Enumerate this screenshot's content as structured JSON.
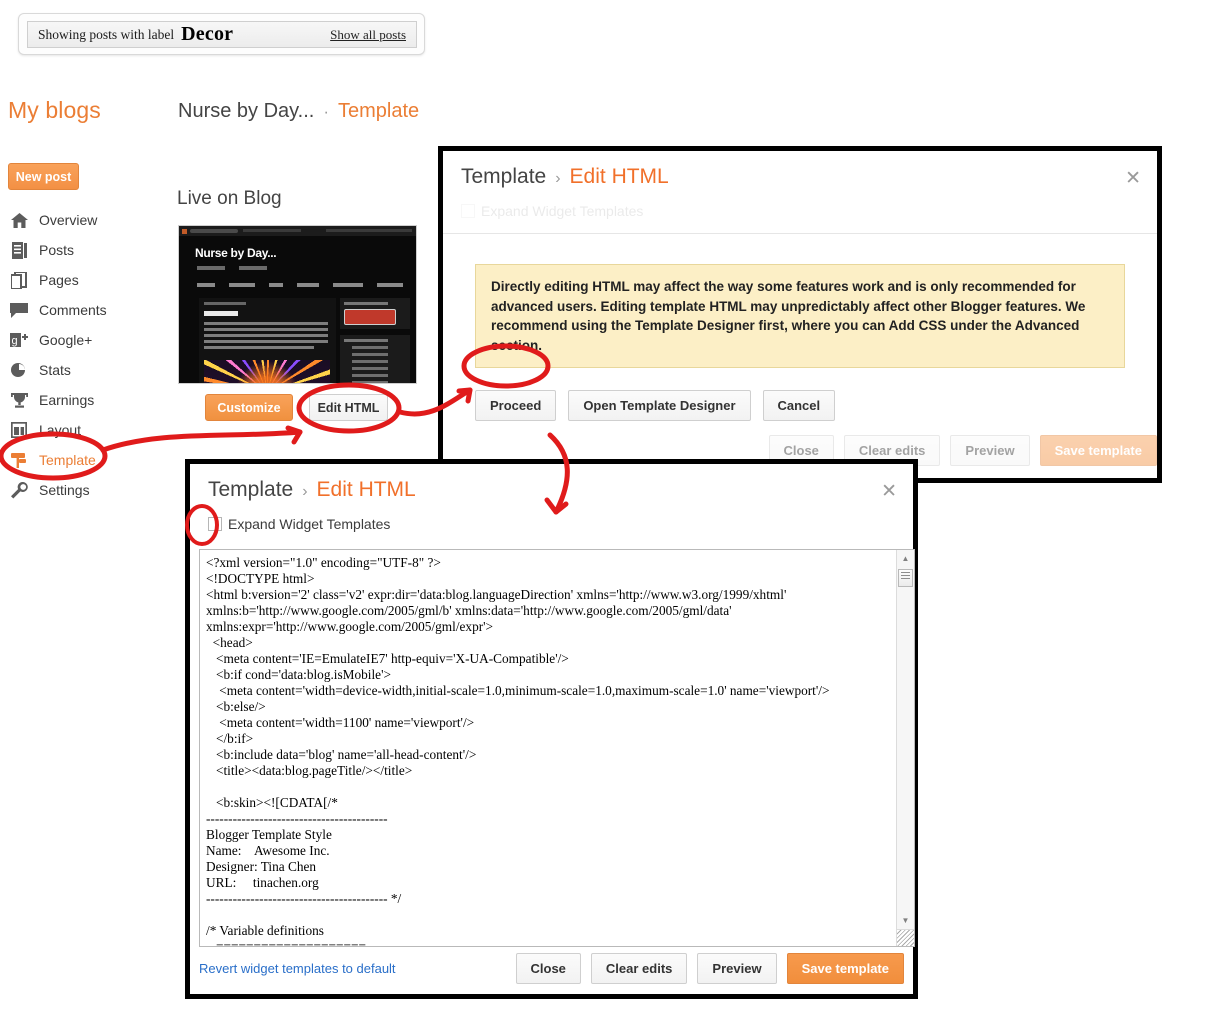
{
  "label_notice": {
    "prefix": "Showing posts with label",
    "label": "Decor",
    "show_all": "Show all posts"
  },
  "header": {
    "my_blogs": "My blogs",
    "blog_name": "Nurse by Day...",
    "separator": "·",
    "current": "Template"
  },
  "sidebar": {
    "new_post": "New post",
    "items": [
      {
        "label": "Overview",
        "icon": "home-icon",
        "active": false
      },
      {
        "label": "Posts",
        "icon": "posts-icon",
        "active": false
      },
      {
        "label": "Pages",
        "icon": "pages-icon",
        "active": false
      },
      {
        "label": "Comments",
        "icon": "comment-icon",
        "active": false
      },
      {
        "label": "Google+",
        "icon": "googleplus-icon",
        "active": false
      },
      {
        "label": "Stats",
        "icon": "stats-icon",
        "active": false
      },
      {
        "label": "Earnings",
        "icon": "trophy-icon",
        "active": false
      },
      {
        "label": "Layout",
        "icon": "layout-icon",
        "active": false
      },
      {
        "label": "Template",
        "icon": "template-icon",
        "active": true
      },
      {
        "label": "Settings",
        "icon": "wrench-icon",
        "active": false
      }
    ]
  },
  "live_on_blog": {
    "title": "Live on Blog",
    "thumbnail_blog_title": "Nurse by Day...",
    "customize": "Customize",
    "edit_html": "Edit HTML"
  },
  "dialog_warning": {
    "crumb_parent": "Template",
    "crumb_sep": "›",
    "crumb_current": "Edit HTML",
    "close_icon": "close-icon",
    "expand_label": "Expand Widget Templates",
    "warning_text": "Directly editing HTML may affect the way some features work and is only recommended for advanced users. Editing template HTML may unpredictably affect other Blogger features. We recommend using the Template Designer first, where you can Add CSS under the Advanced section.",
    "buttons": [
      "Proceed",
      "Open Template Designer",
      "Cancel"
    ],
    "footer_buttons": [
      "Close",
      "Clear edits",
      "Preview",
      "Save template"
    ]
  },
  "dialog_editor": {
    "crumb_parent": "Template",
    "crumb_sep": "›",
    "crumb_current": "Edit HTML",
    "close_icon": "close-icon",
    "expand_label": "Expand Widget Templates",
    "expand_checked": false,
    "code": "<?xml version=\"1.0\" encoding=\"UTF-8\" ?>\n<!DOCTYPE html>\n<html b:version='2' class='v2' expr:dir='data:blog.languageDirection' xmlns='http://www.w3.org/1999/xhtml'\nxmlns:b='http://www.google.com/2005/gml/b' xmlns:data='http://www.google.com/2005/gml/data'\nxmlns:expr='http://www.google.com/2005/gml/expr'>\n  <head>\n   <meta content='IE=EmulateIE7' http-equiv='X-UA-Compatible'/>\n   <b:if cond='data:blog.isMobile'>\n    <meta content='width=device-width,initial-scale=1.0,minimum-scale=1.0,maximum-scale=1.0' name='viewport'/>\n   <b:else/>\n    <meta content='width=1100' name='viewport'/>\n   </b:if>\n   <b:include data='blog' name='all-head-content'/>\n   <title><data:blog.pageTitle/></title>\n\n   <b:skin><![CDATA[/*\n-----------------------------------------\nBlogger Template Style\nName:    Awesome Inc.\nDesigner: Tina Chen\nURL:     tinachen.org\n----------------------------------------- */\n\n/* Variable definitions\n   ====================",
    "revert_link": "Revert widget templates to default",
    "footer_buttons": [
      "Close",
      "Clear edits",
      "Preview",
      "Save template"
    ]
  },
  "annotations": {
    "color": "#e01b1b",
    "marks": [
      "ellipse-around-template-nav",
      "ellipse-around-edit-html-button",
      "ellipse-around-proceed-button",
      "ellipse-around-expand-checkbox",
      "arrow-template-to-edit-html",
      "arrow-edit-html-to-proceed",
      "arrow-proceed-to-editor-dialog"
    ]
  },
  "colors": {
    "accent_orange": "#eb7e35",
    "link_blue": "#2a6fc9",
    "warning_bg": "#fcefc6",
    "annotation_red": "#e01b1b"
  }
}
